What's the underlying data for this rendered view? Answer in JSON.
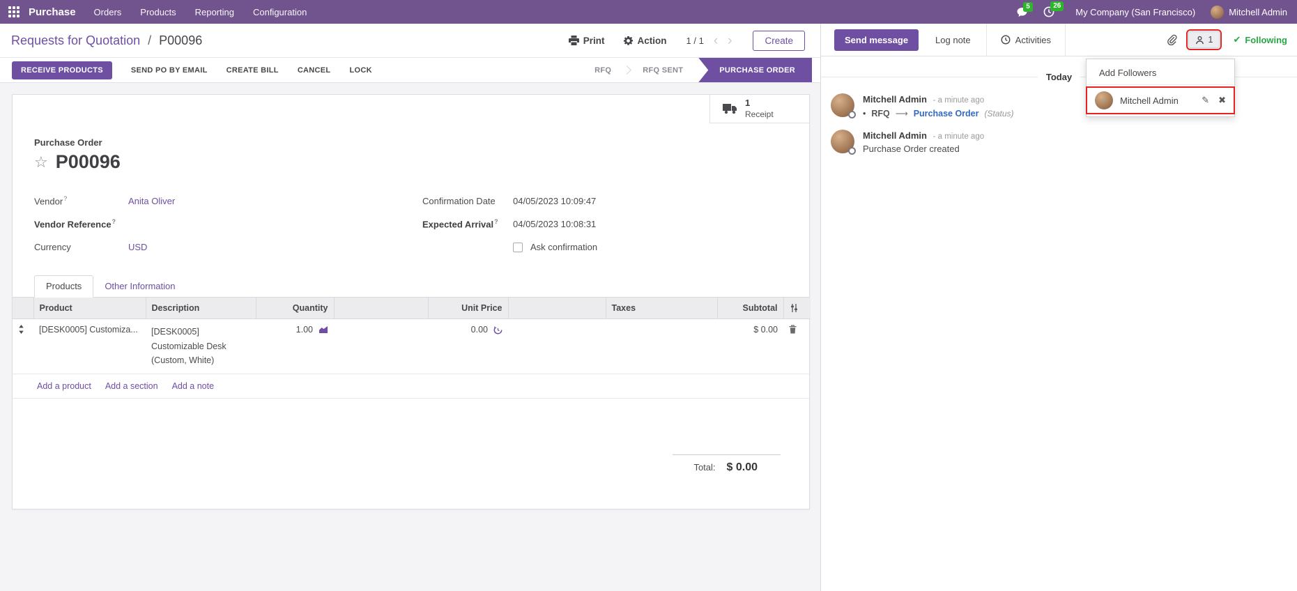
{
  "colors": {
    "navbar_bg": "#71538e",
    "accent_purple": "#6e4fa1",
    "success_green": "#28a745",
    "badge_green": "#2db52c",
    "tracking_link_blue": "#3269c2",
    "annotation_red": "#e8231f",
    "table_header_bg": "#ececef"
  },
  "icons": {
    "check": "✔",
    "star": "☆",
    "bullet": "•",
    "arrow_right": "⟶",
    "chevron_left": "‹",
    "chevron_right": "›",
    "pencil": "✎",
    "close": "✖",
    "question": "?"
  },
  "navbar": {
    "app_name": "Purchase",
    "menus": [
      "Orders",
      "Products",
      "Reporting",
      "Configuration"
    ],
    "messages_badge": "5",
    "activities_badge": "26",
    "company": "My Company (San Francisco)",
    "user": "Mitchell Admin"
  },
  "control_panel": {
    "breadcrumb_parent": "Requests for Quotation",
    "breadcrumb_sep": "/",
    "breadcrumb_current": "P00096",
    "print_label": "Print",
    "action_label": "Action",
    "pager": "1 / 1",
    "create_label": "Create"
  },
  "status_buttons": [
    "RECEIVE PRODUCTS",
    "SEND PO BY EMAIL",
    "CREATE BILL",
    "CANCEL",
    "LOCK"
  ],
  "statusbar": {
    "stages": [
      {
        "label": "RFQ"
      },
      {
        "label": "RFQ SENT"
      },
      {
        "label": "PURCHASE ORDER"
      }
    ]
  },
  "smart_button": {
    "count": "1",
    "label": "Receipt"
  },
  "form": {
    "doc_type_label": "Purchase Order",
    "doc_name": "P00096",
    "fields_left": [
      {
        "label": "Vendor",
        "value": "Anita Oliver"
      },
      {
        "label": "Vendor Reference",
        "value": ""
      },
      {
        "label": "Currency",
        "value": "USD"
      }
    ],
    "fields_right": [
      {
        "label": "Confirmation Date",
        "value": "04/05/2023 10:09:47"
      },
      {
        "label": "Expected Arrival",
        "value": "04/05/2023 10:08:31"
      }
    ],
    "checkbox_label": "Ask confirmation",
    "tabs": [
      {
        "label": "Products"
      },
      {
        "label": "Other Information"
      }
    ],
    "table": {
      "headers": [
        "Product",
        "Description",
        "Quantity",
        "Unit Price",
        "Taxes",
        "Subtotal"
      ],
      "rows": [
        {
          "product": "[DESK0005] Customiza...",
          "description": "[DESK0005]\nCustomizable Desk\n(Custom, White)",
          "quantity": "1.00",
          "unit_price": "0.00",
          "taxes": "",
          "subtotal": "$ 0.00"
        }
      ],
      "add_links": [
        "Add a product",
        "Add a section",
        "Add a note"
      ]
    },
    "total_label": "Total:",
    "total_value": "$ 0.00"
  },
  "chatter": {
    "send_message": "Send message",
    "log_note": "Log note",
    "activities": "Activities",
    "followers_count": "1",
    "following": "Following",
    "dropdown": {
      "add_followers": "Add Followers",
      "follower_name": "Mitchell Admin"
    },
    "date_separator": "Today",
    "messages": [
      {
        "author": "Mitchell Admin",
        "time": "- a minute ago",
        "tracking_from": "RFQ",
        "tracking_to": "Purchase Order",
        "tracking_field": "(Status)"
      },
      {
        "author": "Mitchell Admin",
        "time": "- a minute ago",
        "body": "Purchase Order created"
      }
    ]
  }
}
